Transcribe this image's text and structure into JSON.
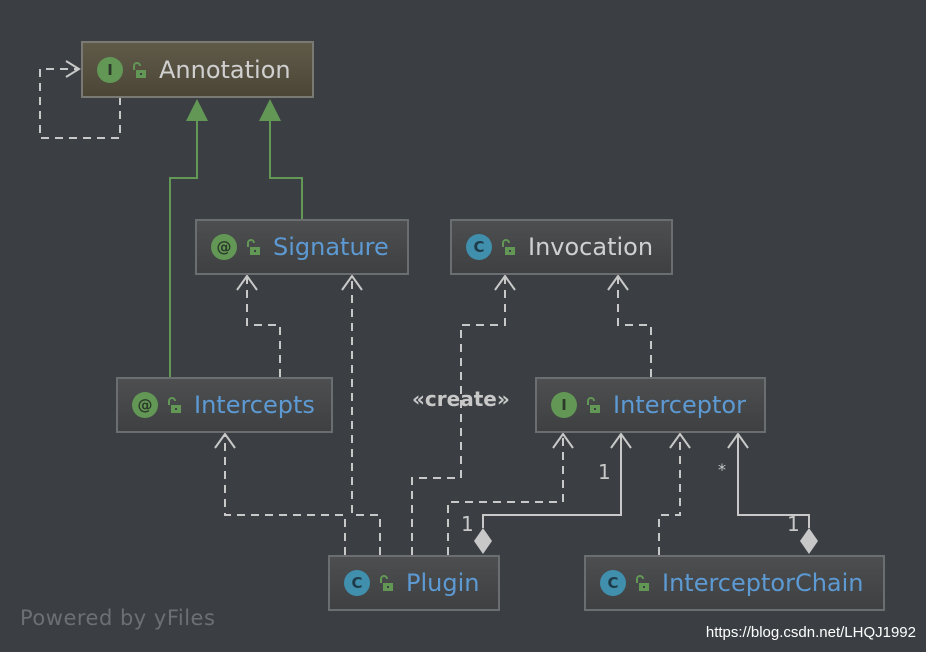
{
  "nodes": {
    "annotation": {
      "name": "Annotation",
      "badge": "I",
      "kind": "interface"
    },
    "signature": {
      "name": "Signature",
      "badge": "@",
      "kind": "annotation"
    },
    "invocation": {
      "name": "Invocation",
      "badge": "C",
      "kind": "class"
    },
    "intercepts": {
      "name": "Intercepts",
      "badge": "@",
      "kind": "annotation"
    },
    "interceptor": {
      "name": "Interceptor",
      "badge": "I",
      "kind": "interface"
    },
    "plugin": {
      "name": "Plugin",
      "badge": "C",
      "kind": "class"
    },
    "interceptorChain": {
      "name": "InterceptorChain",
      "badge": "C",
      "kind": "class"
    }
  },
  "edge_labels": {
    "create": "«create»",
    "plugin_interceptor_target": "1",
    "plugin_interceptor_source": "1",
    "chain_interceptor_target": "*",
    "chain_interceptor_source": "1"
  },
  "footer": "Powered by yFiles",
  "watermark": "https://blog.csdn.net/LHQJ1992",
  "colors": {
    "background": "#3b3f43",
    "inheritance": "#629755",
    "dependency": "#c8c8c8",
    "class_name": "#5d9ad3"
  }
}
